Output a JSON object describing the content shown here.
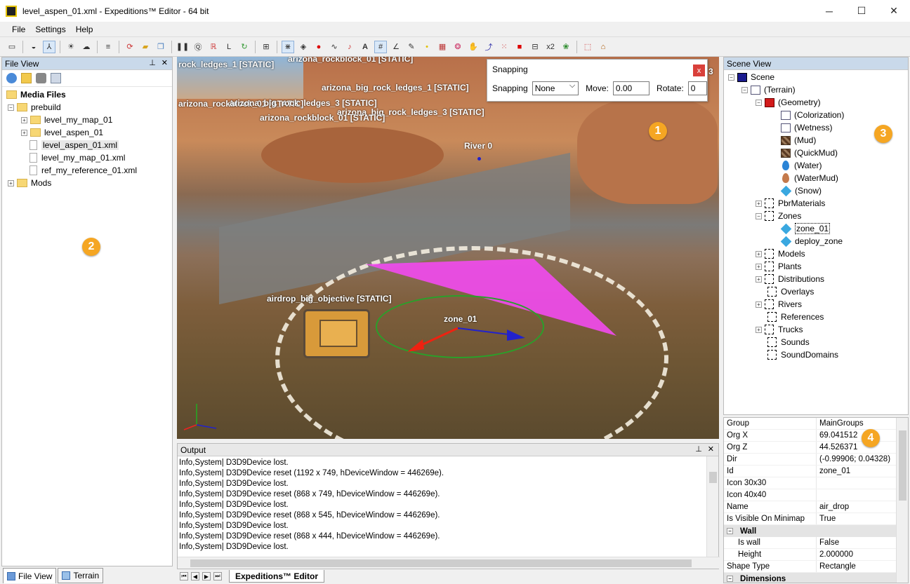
{
  "window": {
    "title": "level_aspen_01.xml - Expeditions™ Editor - 64 bit",
    "minimize": "─",
    "maximize": "☐",
    "close": "✕"
  },
  "menu": [
    "File",
    "Settings",
    "Help"
  ],
  "file_view": {
    "title": "File View",
    "tree": [
      {
        "label": "Media Files",
        "level": 0,
        "type": "folder",
        "bold": true
      },
      {
        "label": "prebuild",
        "level": 1,
        "type": "folder",
        "expander": "−"
      },
      {
        "label": "level_my_map_01",
        "level": 2,
        "type": "folder",
        "expander": "+"
      },
      {
        "label": "level_aspen_01",
        "level": 2,
        "type": "folder",
        "expander": "+"
      },
      {
        "label": "level_aspen_01.xml",
        "level": 2,
        "type": "file",
        "highlight": true
      },
      {
        "label": "level_my_map_01.xml",
        "level": 2,
        "type": "file"
      },
      {
        "label": "ref_my_reference_01.xml",
        "level": 2,
        "type": "file"
      },
      {
        "label": "Mods",
        "level": 1,
        "type": "folder",
        "expander": "+"
      }
    ],
    "tabs": [
      "File View",
      "Terrain"
    ]
  },
  "viewport": {
    "labels": [
      "rock_ledges_1 [STATIC]",
      "arizona_rockblock_01 [STATIC]",
      "arizona_big_rock_ledges_1 [STATIC]",
      "arizona_rockblock_01 [STATIC]",
      "arizona_big_rock_ledges_3 [STATIC]",
      "arizona_big_rock_ledges_3 [STATIC]",
      "arizona_rockblock_01 [STATIC]",
      "River 0",
      "airdrop_big_objective [STATIC]",
      "zone_01"
    ],
    "corner_digit": "3"
  },
  "snapping": {
    "title": "Snapping",
    "close": "x",
    "snapping_label": "Snapping",
    "snapping_value": "None",
    "move_label": "Move:",
    "move_value": "0.00",
    "rotate_label": "Rotate:",
    "rotate_value": "0"
  },
  "markers": [
    "1",
    "2",
    "3",
    "4"
  ],
  "output": {
    "title": "Output",
    "lines": [
      "Info,System| D3D9Device lost.",
      "Info,System| D3D9Device reset (1192 x 749, hDeviceWindow = 446269e).",
      "Info,System| D3D9Device lost.",
      "Info,System| D3D9Device reset (868 x 749, hDeviceWindow = 446269e).",
      "Info,System| D3D9Device lost.",
      "Info,System| D3D9Device reset (868 x 545, hDeviceWindow = 446269e).",
      "Info,System| D3D9Device lost.",
      "Info,System| D3D9Device reset (868 x 444, hDeviceWindow = 446269e).",
      "Info,System| D3D9Device lost."
    ],
    "doc_tab": "Expeditions™ Editor"
  },
  "scene_view": {
    "title": "Scene View",
    "items": [
      {
        "label": "Scene",
        "icon": "scene"
      },
      {
        "label": "(Terrain)",
        "icon": "img"
      },
      {
        "label": "(Geometry)",
        "icon": "cube"
      },
      {
        "label": "(Colorization)",
        "icon": "img"
      },
      {
        "label": "(Wetness)",
        "icon": "img"
      },
      {
        "label": "(Mud)",
        "icon": "mud"
      },
      {
        "label": "(QuickMud)",
        "icon": "mud"
      },
      {
        "label": "(Water)",
        "icon": "drop-blue"
      },
      {
        "label": "(WaterMud)",
        "icon": "drop-brown"
      },
      {
        "label": "(Snow)",
        "icon": "diamond"
      },
      {
        "label": "PbrMaterials",
        "icon": "dashed"
      },
      {
        "label": "Zones",
        "icon": "dashed"
      },
      {
        "label": "zone_01",
        "icon": "diamond"
      },
      {
        "label": "deploy_zone",
        "icon": "diamond"
      },
      {
        "label": "Models",
        "icon": "dashed"
      },
      {
        "label": "Plants",
        "icon": "dashed"
      },
      {
        "label": "Distributions",
        "icon": "dashed"
      },
      {
        "label": "Overlays",
        "icon": "dashed"
      },
      {
        "label": "Rivers",
        "icon": "dashed"
      },
      {
        "label": "References",
        "icon": "dashed"
      },
      {
        "label": "Trucks",
        "icon": "dashed"
      },
      {
        "label": "Sounds",
        "icon": "dashed"
      },
      {
        "label": "SoundDomains",
        "icon": "dashed"
      }
    ]
  },
  "properties": {
    "rows": [
      {
        "name": "Group",
        "value": "MainGroups"
      },
      {
        "name": "Org X",
        "value": "69.041512"
      },
      {
        "name": "Org Z",
        "value": "44.526371"
      },
      {
        "name": "Dir",
        "value": "(-0.99906; 0.04328)"
      },
      {
        "name": "Id",
        "value": "zone_01"
      },
      {
        "name": "Icon 30x30",
        "value": ""
      },
      {
        "name": "Icon 40x40",
        "value": ""
      },
      {
        "name": "Name",
        "value": "air_drop"
      },
      {
        "name": "Is Visible On Minimap",
        "value": "True"
      }
    ],
    "wall_category": "Wall",
    "wall_rows": [
      {
        "name": "Is wall",
        "value": "False"
      },
      {
        "name": "Height",
        "value": "2.000000"
      },
      {
        "name": "Shape Type",
        "value": "Rectangle"
      }
    ],
    "dimensions_category": "Dimensions"
  }
}
